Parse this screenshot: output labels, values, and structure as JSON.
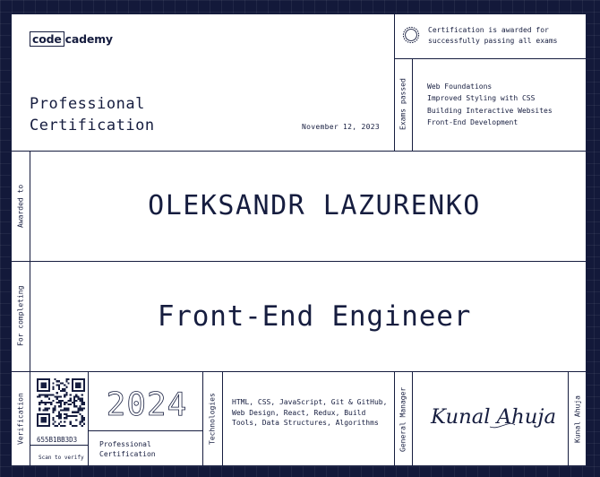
{
  "brand": {
    "logo_boxed": "code",
    "logo_rest": "cademy"
  },
  "certificate": {
    "title_line1": "Professional",
    "title_line2": "Certification",
    "date": "November 12, 2023",
    "badge_text_line1": "Certification is awarded for",
    "badge_text_line2": "successfully passing all exams",
    "exams_label": "Exams passed",
    "exams": [
      "Web Foundations",
      "Improved Styling with CSS",
      "Building Interactive Websites",
      "Front-End Development"
    ],
    "awarded_label": "Awarded to",
    "recipient": "OLEKSANDR LAZURENKO",
    "completing_label": "For completing",
    "course": "Front-End Engineer",
    "verification_label": "Verification",
    "verification_code": "655B1BB3D3",
    "scan_text": "Scan to verify",
    "year": "2024",
    "cert_type_line1": "Professional",
    "cert_type_line2": "Certification",
    "technologies_label": "Technologies",
    "technologies": "HTML, CSS, JavaScript, Git & GitHub, Web Design, React, Redux, Build Tools, Data Structures, Algorithms",
    "manager_label": "General Manager",
    "manager_name": "Kunal Ahuja",
    "signature_text": "Kunal Ahuja"
  },
  "colors": {
    "navy": "#161d3f",
    "background": "#13193a",
    "paper": "#ffffff"
  },
  "icons": {
    "badge": "rosette-badge-icon",
    "qr": "qr-code-icon"
  }
}
